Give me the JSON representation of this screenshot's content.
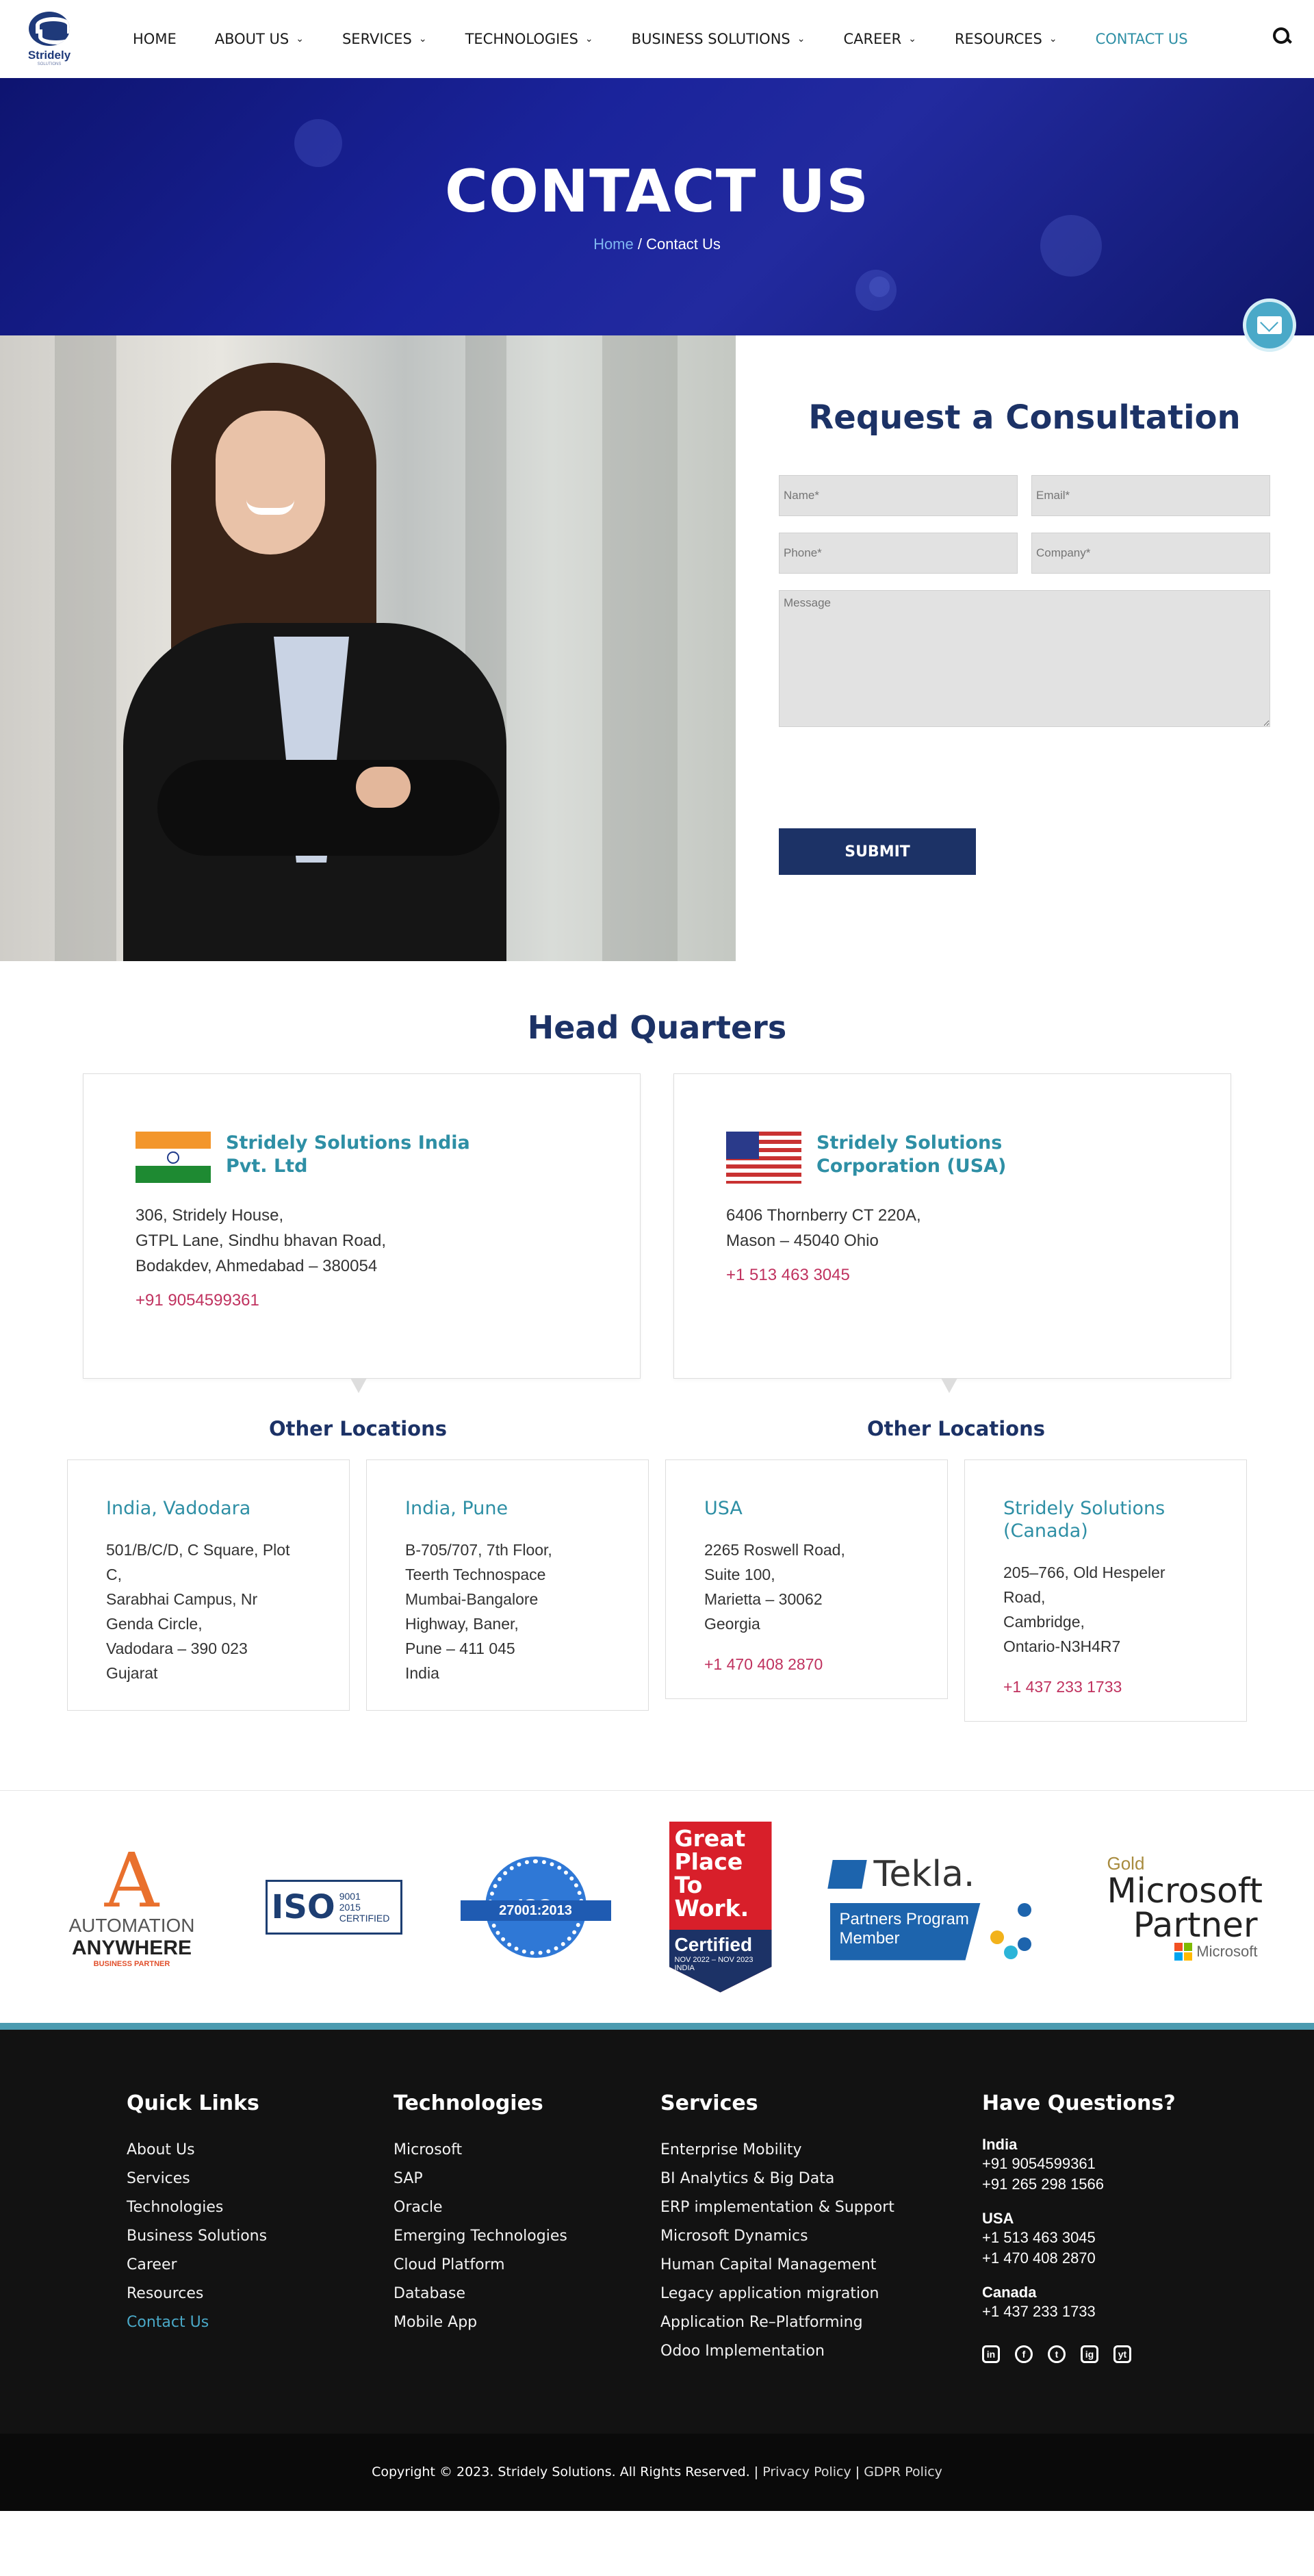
{
  "nav": {
    "logo_text": "Stridely",
    "logo_sub": "SOLUTIONS",
    "items": [
      {
        "label": "HOME",
        "dropdown": false
      },
      {
        "label": "ABOUT US",
        "dropdown": true
      },
      {
        "label": "SERVICES",
        "dropdown": true
      },
      {
        "label": "TECHNOLOGIES",
        "dropdown": true
      },
      {
        "label": "BUSINESS SOLUTIONS",
        "dropdown": true
      },
      {
        "label": "CAREER",
        "dropdown": true
      },
      {
        "label": "RESOURCES",
        "dropdown": true
      },
      {
        "label": "CONTACT US",
        "dropdown": false
      }
    ],
    "chevron": "⌄"
  },
  "hero": {
    "title": "CONTACT US",
    "breadcrumb_home": "Home",
    "breadcrumb_sep": " / ",
    "breadcrumb_current": "Contact Us"
  },
  "form": {
    "title": "Request a Consultation",
    "name_placeholder": "Name*",
    "email_placeholder": "Email*",
    "phone_placeholder": "Phone*",
    "company_placeholder": "Company*",
    "message_placeholder": "Message",
    "submit_label": "SUBMIT"
  },
  "hq": {
    "title": "Head Quarters",
    "india": {
      "name": "Stridely Solutions India Pvt. Ltd",
      "address": [
        "306, Stridely House,",
        "GTPL Lane, Sindhu bhavan Road,",
        "Bodakdev, Ahmedabad – 380054"
      ],
      "phone": "+91 9054599361"
    },
    "usa": {
      "name": "Stridely Solutions Corporation (USA)",
      "address": [
        "6406 Thornberry CT 220A,",
        "Mason – 45040 Ohio"
      ],
      "phone": "+1 513 463 3045"
    }
  },
  "other": {
    "title": "Other Locations",
    "india_locations": [
      {
        "name": "India, Vadodara",
        "address": [
          "501/B/C/D, C Square, Plot",
          "C,",
          "Sarabhai Campus, Nr",
          "Genda Circle,",
          "Vadodara – 390 023",
          "Gujarat"
        ],
        "phone": ""
      },
      {
        "name": "India, Pune",
        "address": [
          "B-705/707, 7th Floor,",
          "Teerth Technospace",
          "Mumbai-Bangalore",
          "Highway, Baner,",
          "Pune – 411 045",
          "India"
        ],
        "phone": ""
      }
    ],
    "usa_locations": [
      {
        "name": "USA",
        "address": [
          "2265 Roswell Road,",
          "Suite 100,",
          "Marietta – 30062",
          "Georgia"
        ],
        "phone": "+1 470 408 2870"
      },
      {
        "name": "Stridely Solutions (Canada)",
        "address": [
          "205–766, Old Hespeler",
          "Road,",
          "Cambridge,",
          "Ontario-N3H4R7"
        ],
        "phone": "+1 437 233 1733"
      }
    ]
  },
  "partners": {
    "aa": {
      "line1": "AUTOMATION",
      "line2": "ANYWHERE",
      "line3": "BUSINESS PARTNER"
    },
    "iso1": {
      "big": "ISO",
      "small1": "9001",
      "small2": "2015",
      "small3": "CERTIFIED"
    },
    "iso2": {
      "big": "ISO",
      "ribbon": "27001:2013"
    },
    "gptw": {
      "line1": "Great",
      "line2": "Place",
      "line3": "To",
      "line4": "Work.",
      "cert": "Certified",
      "dates": "NOV 2022 – NOV 2023",
      "country": "INDIA"
    },
    "tekla": {
      "name": "Tekla.",
      "box1": "Partners Program",
      "box2": "Member"
    },
    "ms": {
      "gold": "Gold",
      "name": "Microsoft",
      "partner": "Partner",
      "brand": "Microsoft"
    }
  },
  "footer": {
    "quick": {
      "title": "Quick Links",
      "items": [
        "About Us",
        "Services",
        "Technologies",
        "Business Solutions",
        "Career",
        "Resources",
        "Contact Us"
      ]
    },
    "tech": {
      "title": "Technologies",
      "items": [
        "Microsoft",
        "SAP",
        "Oracle",
        "Emerging Technologies",
        "Cloud Platform",
        "Database",
        "Mobile App"
      ]
    },
    "services": {
      "title": "Services",
      "items": [
        "Enterprise Mobility",
        "BI Analytics & Big Data",
        "ERP implementation & Support",
        "Microsoft Dynamics",
        "Human Capital Management",
        "Legacy application migration",
        "Application Re–Platforming",
        "Odoo Implementation"
      ]
    },
    "questions": {
      "title": "Have Questions?",
      "india_label": "India",
      "india_1": "+91 9054599361",
      "india_2": "+91 265 298 1566",
      "usa_label": "USA",
      "usa_1": "+1 513 463 3045",
      "usa_2": "+1 470 408 2870",
      "canada_label": "Canada",
      "canada_1": "+1 437 233 1733"
    },
    "socials": [
      "in",
      "f",
      "t",
      "ig",
      "yt"
    ]
  },
  "copyright": {
    "text": "Copyright © 2023. Stridely Solutions. All Rights Reserved. | ",
    "privacy": "Privacy Policy",
    "sep": " | ",
    "gdpr": "GDPR Policy"
  },
  "colors": {
    "primary": "#1c3266",
    "accent": "#2e8fa5",
    "phone": "#c0325f",
    "hero": "#1a239b"
  }
}
